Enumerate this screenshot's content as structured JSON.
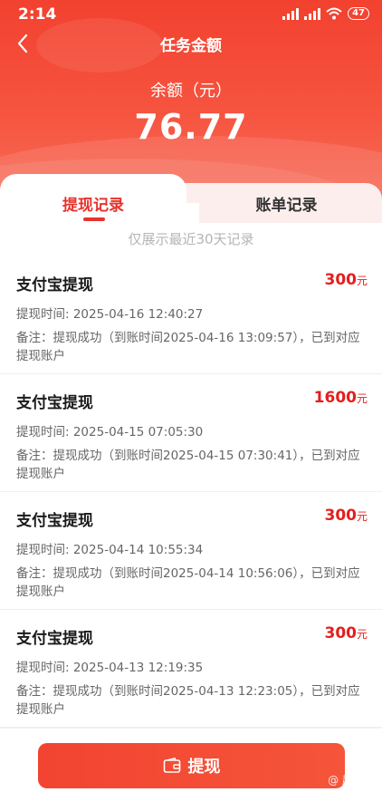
{
  "statusbar": {
    "time": "2:14",
    "battery": "47"
  },
  "nav": {
    "title": "任务金额"
  },
  "balance": {
    "label": "余额（元）",
    "value": "76.77"
  },
  "tabs": [
    {
      "label": "提现记录",
      "active": true
    },
    {
      "label": "账单记录",
      "active": false
    }
  ],
  "notice": "仅展示最近30天记录",
  "records": [
    {
      "title": "支付宝提现",
      "amount": "300",
      "unit": "元",
      "time": "提现时间: 2025-04-16 12:40:27",
      "note": "备注：提现成功（到账时间2025-04-16 13:09:57），已到对应提现账户"
    },
    {
      "title": "支付宝提现",
      "amount": "1600",
      "unit": "元",
      "time": "提现时间: 2025-04-15 07:05:30",
      "note": "备注：提现成功（到账时间2025-04-15 07:30:41），已到对应提现账户"
    },
    {
      "title": "支付宝提现",
      "amount": "300",
      "unit": "元",
      "time": "提现时间: 2025-04-14 10:55:34",
      "note": "备注：提现成功（到账时间2025-04-14 10:56:06），已到对应提现账户"
    },
    {
      "title": "支付宝提现",
      "amount": "300",
      "unit": "元",
      "time": "提现时间: 2025-04-13 12:19:35",
      "note": "备注：提现成功（到账时间2025-04-13 12:23:05），已到对应提现账户"
    }
  ],
  "bottom": {
    "button_label": "提现",
    "watermark": "@ 趣搜网"
  },
  "colors": {
    "accent": "#e8322c",
    "header": "#f2412f",
    "amount": "#e41e1e"
  },
  "icons": {
    "back": "chevron-left-icon",
    "wallet": "wallet-icon"
  }
}
